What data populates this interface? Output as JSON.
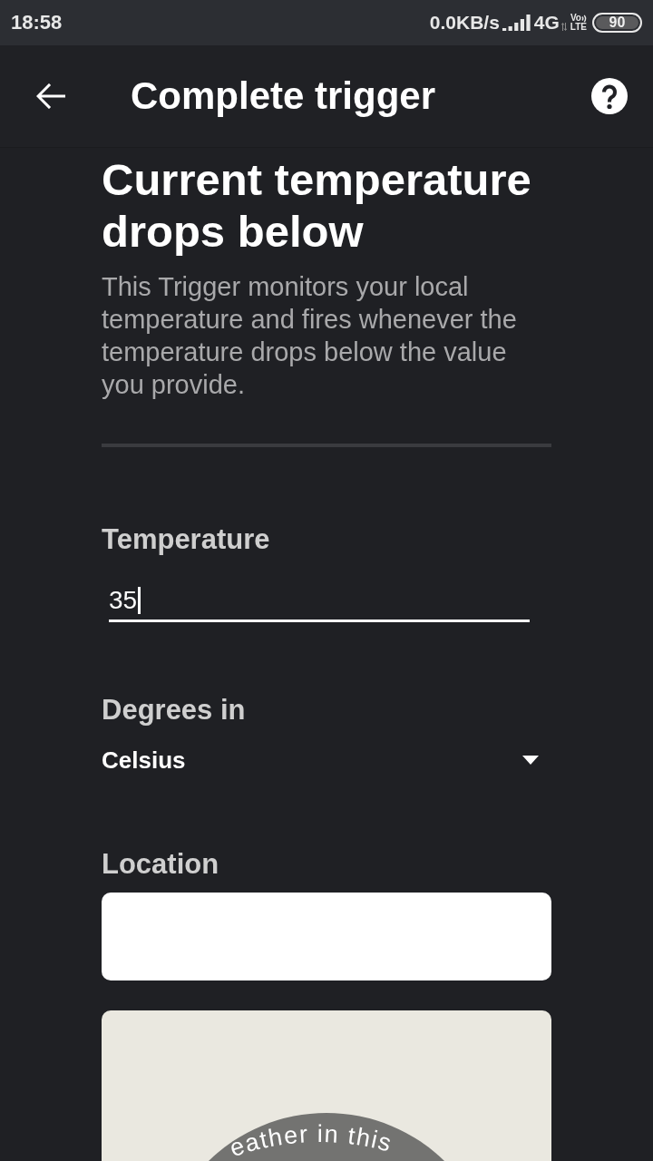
{
  "status_bar": {
    "time": "18:58",
    "network_speed": "0.0KB/s",
    "network_type": "4G",
    "volte_top": "Vo",
    "volte_bottom": "LTE",
    "battery": "90"
  },
  "app_bar": {
    "title": "Complete trigger"
  },
  "trigger": {
    "title": "Current temperature drops below",
    "description": "This Trigger monitors your local temperature and fires whenever the temperature drops below the value you provide."
  },
  "fields": [
    {
      "kind": "text",
      "label": "Temperature",
      "value": "35",
      "focused": true
    },
    {
      "kind": "dropdown",
      "label": "Degrees in",
      "value": "Celsius"
    },
    {
      "kind": "location",
      "label": "Location"
    }
  ],
  "map": {
    "caption": "eather in this"
  }
}
